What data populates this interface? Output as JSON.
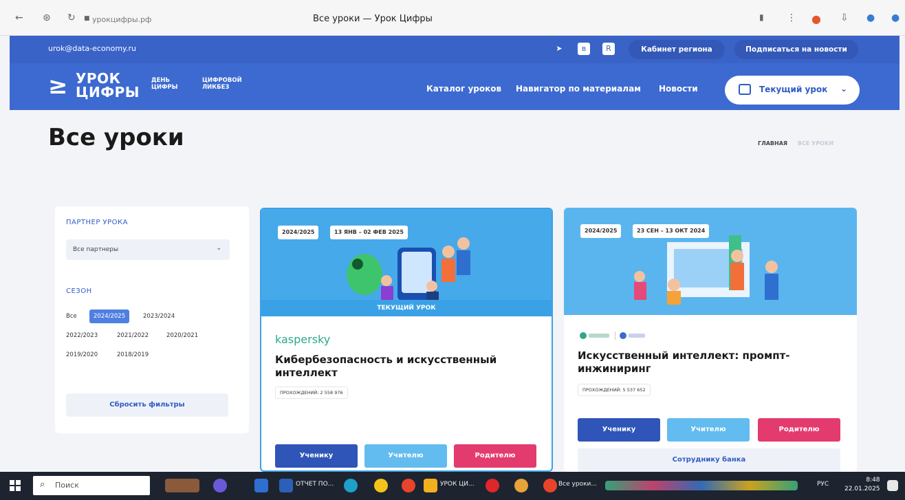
{
  "browser": {
    "url": "урокцифры.рф",
    "tab_title": "Все уроки — Урок Цифры"
  },
  "topbar": {
    "email": "urok@data-economy.ru",
    "cabinet": "Кабинет региона",
    "subscribe": "Подписаться на новости"
  },
  "header": {
    "logo_line1": "УРОК",
    "logo_line2": "ЦИФРЫ",
    "day_line1": "ДЕНЬ",
    "day_line2": "ЦИФРЫ",
    "likbez_line1": "ЦИФРОВОЙ",
    "likbez_line2": "ЛИКБЕЗ",
    "nav": {
      "catalog": "Каталог уроков",
      "navigator": "Навигатор по материалам",
      "news": "Новости"
    },
    "current_lesson": "Текущий урок"
  },
  "page": {
    "title": "Все уроки",
    "breadcrumb_home": "ГЛАВНАЯ",
    "breadcrumb_current": "ВСЕ УРОКИ"
  },
  "filters": {
    "partner_label": "ПАРТНЕР УРОКА",
    "partner_value": "Все партнеры",
    "season_label": "СЕЗОН",
    "seasons": [
      "Все",
      "2024/2025",
      "2023/2024",
      "2022/2023",
      "2021/2022",
      "2020/2021",
      "2019/2020",
      "2018/2019"
    ],
    "reset": "Сбросить фильтры"
  },
  "cards": [
    {
      "season": "2024/2025",
      "dates": "13 ЯНВ – 02 ФЕВ 2025",
      "current_tag": "ТЕКУЩИЙ УРОК",
      "brand": "kaspersky",
      "title": "Кибербезопасность и искусственный интеллект",
      "passes": "ПРОХОЖДЕНИЙ: 2 558 976",
      "btn_student": "Ученику",
      "btn_teacher": "Учителю",
      "btn_parent": "Родителю"
    },
    {
      "season": "2024/2025",
      "dates": "23 СЕН – 13 ОКТ 2024",
      "title": "Искусственный интеллект: промпт-инжиниринг",
      "passes": "ПРОХОЖДЕНИЙ: 5 537 652",
      "btn_student": "Ученику",
      "btn_teacher": "Учителю",
      "btn_parent": "Родителю",
      "btn_bank": "Сотруднику банка"
    }
  ],
  "taskbar": {
    "search": "Поиск",
    "app1": "ОТЧЕТ ПО...",
    "app2": "УРОК ЦИ...",
    "app3": "Все уроки...",
    "lang": "РУС",
    "time": "8:48",
    "date": "22.01.2025"
  },
  "colors": {
    "brand_blue": "#3d6ad0",
    "accent_pink": "#e43b6f",
    "accent_light": "#63bcef"
  }
}
